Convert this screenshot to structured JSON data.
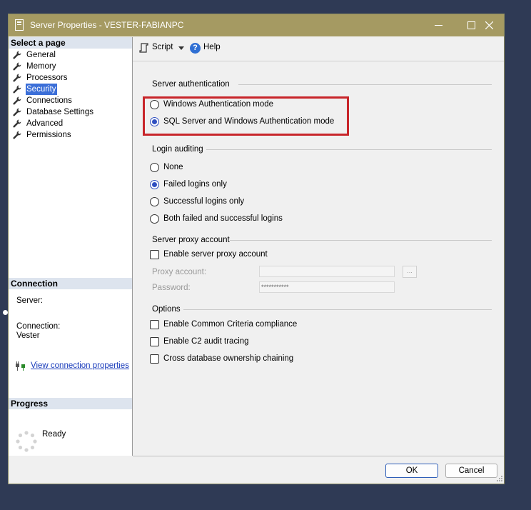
{
  "window": {
    "title": "Server Properties - VESTER-FABIANPC",
    "controls": [
      "minimize-icon",
      "maximize-icon",
      "close-icon"
    ]
  },
  "left_pane": {
    "select_page_header": "Select a page",
    "pages": [
      {
        "label": "General",
        "icon": "wrench-icon",
        "selected": false
      },
      {
        "label": "Memory",
        "icon": "wrench-icon",
        "selected": false
      },
      {
        "label": "Processors",
        "icon": "wrench-icon",
        "selected": false
      },
      {
        "label": "Security",
        "icon": "wrench-icon",
        "selected": true
      },
      {
        "label": "Connections",
        "icon": "wrench-icon",
        "selected": false
      },
      {
        "label": "Database Settings",
        "icon": "wrench-icon",
        "selected": false
      },
      {
        "label": "Advanced",
        "icon": "wrench-icon",
        "selected": false
      },
      {
        "label": "Permissions",
        "icon": "wrench-icon",
        "selected": false
      }
    ],
    "connection_header": "Connection",
    "server_label": "Server:",
    "connection_label": "Connection:",
    "connection_value": "Vester",
    "view_connection_link": "View connection properties",
    "progress_header": "Progress",
    "progress_status": "Ready"
  },
  "toolbar": {
    "script_label": "Script",
    "help_label": "Help"
  },
  "server_authentication": {
    "title": "Server authentication",
    "options": [
      {
        "label": "Windows Authentication mode",
        "checked": false
      },
      {
        "label": "SQL Server and Windows Authentication mode",
        "checked": true
      }
    ],
    "highlight_color": "#c8252a"
  },
  "login_auditing": {
    "title": "Login auditing",
    "options": [
      {
        "label": "None",
        "checked": false
      },
      {
        "label": "Failed logins only",
        "checked": true
      },
      {
        "label": "Successful logins only",
        "checked": false
      },
      {
        "label": "Both failed and successful logins",
        "checked": false
      }
    ]
  },
  "server_proxy": {
    "title": "Server proxy account",
    "enable_label": "Enable server proxy account",
    "enabled": false,
    "proxy_account_label": "Proxy account:",
    "proxy_account_value": "",
    "browse_label": "...",
    "password_label": "Password:",
    "password_value": "***********"
  },
  "options": {
    "title": "Options",
    "items": [
      {
        "label": "Enable Common Criteria compliance",
        "checked": false
      },
      {
        "label": "Enable C2 audit tracing",
        "checked": false
      },
      {
        "label": "Cross database ownership chaining",
        "checked": false
      }
    ]
  },
  "buttons": {
    "ok": "OK",
    "cancel": "Cancel"
  },
  "colors": {
    "titlebar": "#a59a62",
    "accent": "#3c6fd8",
    "link": "#1a3cbb",
    "desktop": "#2f3a55"
  }
}
